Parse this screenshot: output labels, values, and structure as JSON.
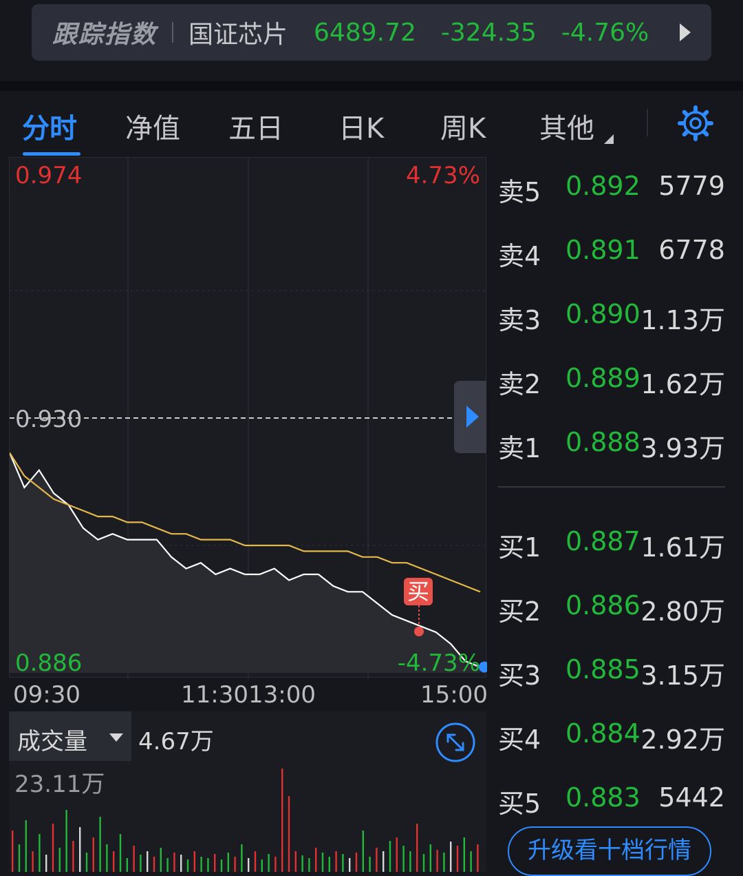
{
  "tracking": {
    "label": "跟踪指数",
    "index_name": "国证芯片",
    "value": "6489.72",
    "change": "-324.35",
    "change_pct": "-4.76%",
    "arrow_icon": "triangle-right-icon"
  },
  "tabs": [
    {
      "label": "分时",
      "active": true
    },
    {
      "label": "净值",
      "active": false
    },
    {
      "label": "五日",
      "active": false
    },
    {
      "label": "日K",
      "active": false
    },
    {
      "label": "周K",
      "active": false
    },
    {
      "label": "其他",
      "active": false
    }
  ],
  "settings_icon": "gear-icon",
  "chart": {
    "price_high": "0.974",
    "pct_high": "4.73%",
    "price_mid": "0.930",
    "price_low": "0.886",
    "pct_low": "-4.73%",
    "buy_marker": "买",
    "time_labels": [
      "09:30",
      "11:30",
      "13:00",
      "15:00"
    ]
  },
  "chart_data": {
    "type": "line",
    "x_range": [
      "09:30",
      "15:00"
    ],
    "ylim": [
      0.886,
      0.974
    ],
    "reference_price": 0.93,
    "series": [
      {
        "color": "#ffffff",
        "values": [
          0.924,
          0.918,
          0.921,
          0.917,
          0.915,
          0.911,
          0.909,
          0.91,
          0.909,
          0.909,
          0.909,
          0.906,
          0.904,
          0.905,
          0.903,
          0.904,
          0.903,
          0.903,
          0.904,
          0.902,
          0.903,
          0.903,
          0.901,
          0.9,
          0.9,
          0.898,
          0.896,
          0.895,
          0.894,
          0.893,
          0.891,
          0.888,
          0.887
        ]
      },
      {
        "color": "#e6b84a",
        "values": [
          0.924,
          0.92,
          0.918,
          0.916,
          0.915,
          0.914,
          0.913,
          0.913,
          0.912,
          0.912,
          0.911,
          0.91,
          0.91,
          0.909,
          0.909,
          0.909,
          0.908,
          0.908,
          0.908,
          0.908,
          0.907,
          0.907,
          0.907,
          0.907,
          0.906,
          0.906,
          0.905,
          0.905,
          0.904,
          0.903,
          0.902,
          0.901,
          0.9
        ]
      }
    ],
    "grid": true
  },
  "volume": {
    "selector_label": "成交量",
    "current": "4.67万",
    "max_label": "23.11万",
    "expand_icon": "expand-arrows-icon"
  },
  "order_book": {
    "asks": [
      {
        "label": "卖5",
        "price": "0.892",
        "volume": "5779"
      },
      {
        "label": "卖4",
        "price": "0.891",
        "volume": "6778"
      },
      {
        "label": "卖3",
        "price": "0.890",
        "volume": "1.13万"
      },
      {
        "label": "卖2",
        "price": "0.889",
        "volume": "1.62万"
      },
      {
        "label": "卖1",
        "price": "0.888",
        "volume": "3.93万"
      }
    ],
    "bids": [
      {
        "label": "买1",
        "price": "0.887",
        "volume": "1.61万"
      },
      {
        "label": "买2",
        "price": "0.886",
        "volume": "2.80万"
      },
      {
        "label": "买3",
        "price": "0.885",
        "volume": "3.15万"
      },
      {
        "label": "买4",
        "price": "0.884",
        "volume": "2.92万"
      },
      {
        "label": "买5",
        "price": "0.883",
        "volume": "5442"
      }
    ],
    "upgrade_label": "升级看十档行情"
  },
  "colors": {
    "up": "#e03030",
    "down": "#22b83a",
    "accent": "#2f8cff",
    "avg_line": "#e6b84a"
  }
}
